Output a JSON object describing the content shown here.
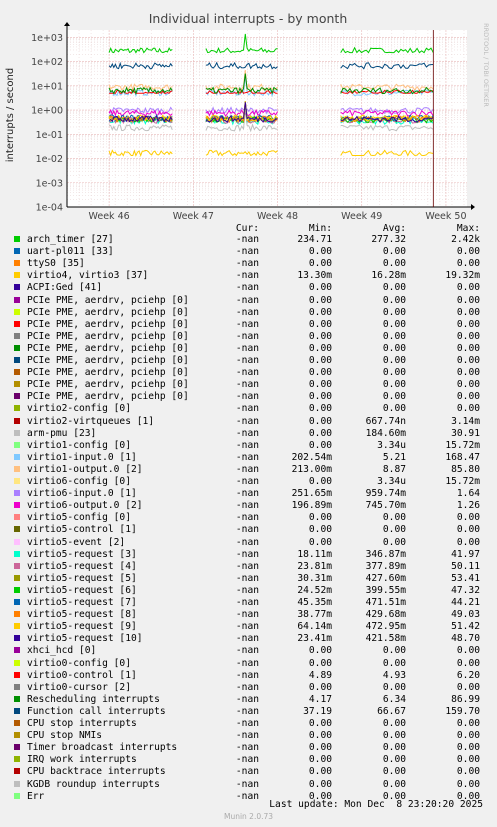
{
  "chart_data": {
    "type": "line",
    "title": "Individual interrupts - by month",
    "ylabel": "interrupts / second",
    "side_label": "RRDTOOL / TOBI OETIKER",
    "y_scale": "log",
    "ylim": [
      0.0001,
      2000
    ],
    "y_ticks": [
      "1e-04",
      "1e-03",
      "1e-02",
      "1e-01",
      "1e+00",
      "1e+01",
      "1e+02",
      "1e+03"
    ],
    "x_ticks": [
      "Week 46",
      "Week 47",
      "Week 48",
      "Week 49",
      "Week 50"
    ],
    "grid": true,
    "data_segments": [
      [
        46.0,
        46.75
      ],
      [
        47.15,
        48.0
      ],
      [
        48.75,
        49.85
      ]
    ],
    "now_marker": 49.85,
    "series": [
      {
        "name": "arch_timer [27]",
        "color": "#00cc00",
        "cur": "-nan",
        "min": "234.71",
        "avg": "277.32",
        "max": "2.42k"
      },
      {
        "name": "uart-pl011 [33]",
        "color": "#0066b3",
        "cur": "-nan",
        "min": "0.00",
        "avg": "0.00",
        "max": "0.00"
      },
      {
        "name": "ttyS0 [35]",
        "color": "#ff8000",
        "cur": "-nan",
        "min": "0.00",
        "avg": "0.00",
        "max": "0.00"
      },
      {
        "name": "virtio4, virtio3 [37]",
        "color": "#ffcc00",
        "cur": "-nan",
        "min": "13.30m",
        "avg": "16.28m",
        "max": "19.32m"
      },
      {
        "name": "ACPI:Ged [41]",
        "color": "#330099",
        "cur": "-nan",
        "min": "0.00",
        "avg": "0.00",
        "max": "0.00"
      },
      {
        "name": "PCIe PME, aerdrv, pciehp [0]",
        "color": "#990099",
        "cur": "-nan",
        "min": "0.00",
        "avg": "0.00",
        "max": "0.00"
      },
      {
        "name": "PCIe PME, aerdrv, pciehp [0]",
        "color": "#ccff00",
        "cur": "-nan",
        "min": "0.00",
        "avg": "0.00",
        "max": "0.00"
      },
      {
        "name": "PCIe PME, aerdrv, pciehp [0]",
        "color": "#ff0000",
        "cur": "-nan",
        "min": "0.00",
        "avg": "0.00",
        "max": "0.00"
      },
      {
        "name": "PCIe PME, aerdrv, pciehp [0]",
        "color": "#808080",
        "cur": "-nan",
        "min": "0.00",
        "avg": "0.00",
        "max": "0.00"
      },
      {
        "name": "PCIe PME, aerdrv, pciehp [0]",
        "color": "#008f00",
        "cur": "-nan",
        "min": "0.00",
        "avg": "0.00",
        "max": "0.00"
      },
      {
        "name": "PCIe PME, aerdrv, pciehp [0]",
        "color": "#00487d",
        "cur": "-nan",
        "min": "0.00",
        "avg": "0.00",
        "max": "0.00"
      },
      {
        "name": "PCIe PME, aerdrv, pciehp [0]",
        "color": "#b35a00",
        "cur": "-nan",
        "min": "0.00",
        "avg": "0.00",
        "max": "0.00"
      },
      {
        "name": "PCIe PME, aerdrv, pciehp [0]",
        "color": "#b38f00",
        "cur": "-nan",
        "min": "0.00",
        "avg": "0.00",
        "max": "0.00"
      },
      {
        "name": "PCIe PME, aerdrv, pciehp [0]",
        "color": "#6b006b",
        "cur": "-nan",
        "min": "0.00",
        "avg": "0.00",
        "max": "0.00"
      },
      {
        "name": "virtio2-config [0]",
        "color": "#8fb300",
        "cur": "-nan",
        "min": "0.00",
        "avg": "0.00",
        "max": "0.00"
      },
      {
        "name": "virtio2-virtqueues [1]",
        "color": "#b30000",
        "cur": "-nan",
        "min": "0.00",
        "avg": "667.74n",
        "max": "3.14m"
      },
      {
        "name": "arm-pmu [23]",
        "color": "#bebebe",
        "cur": "-nan",
        "min": "0.00",
        "avg": "184.60m",
        "max": "30.91"
      },
      {
        "name": "virtio1-config [0]",
        "color": "#80ff80",
        "cur": "-nan",
        "min": "0.00",
        "avg": "3.34u",
        "max": "15.72m"
      },
      {
        "name": "virtio1-input.0 [1]",
        "color": "#80c9ff",
        "cur": "-nan",
        "min": "202.54m",
        "avg": "5.21",
        "max": "168.47"
      },
      {
        "name": "virtio1-output.0 [2]",
        "color": "#ffc080",
        "cur": "-nan",
        "min": "213.00m",
        "avg": "8.87",
        "max": "85.80"
      },
      {
        "name": "virtio6-config [0]",
        "color": "#ffe680",
        "cur": "-nan",
        "min": "0.00",
        "avg": "3.34u",
        "max": "15.72m"
      },
      {
        "name": "virtio6-input.0 [1]",
        "color": "#aa80ff",
        "cur": "-nan",
        "min": "251.65m",
        "avg": "959.74m",
        "max": "1.64"
      },
      {
        "name": "virtio6-output.0 [2]",
        "color": "#ee00cc",
        "cur": "-nan",
        "min": "196.89m",
        "avg": "745.70m",
        "max": "1.26"
      },
      {
        "name": "virtio5-config [0]",
        "color": "#ff8080",
        "cur": "-nan",
        "min": "0.00",
        "avg": "0.00",
        "max": "0.00"
      },
      {
        "name": "virtio5-control [1]",
        "color": "#666600",
        "cur": "-nan",
        "min": "0.00",
        "avg": "0.00",
        "max": "0.00"
      },
      {
        "name": "virtio5-event [2]",
        "color": "#ffbfff",
        "cur": "-nan",
        "min": "0.00",
        "avg": "0.00",
        "max": "0.00"
      },
      {
        "name": "virtio5-request [3]",
        "color": "#00ffcc",
        "cur": "-nan",
        "min": "18.11m",
        "avg": "346.87m",
        "max": "41.97"
      },
      {
        "name": "virtio5-request [4]",
        "color": "#cc6699",
        "cur": "-nan",
        "min": "23.81m",
        "avg": "377.89m",
        "max": "50.11"
      },
      {
        "name": "virtio5-request [5]",
        "color": "#999900",
        "cur": "-nan",
        "min": "30.31m",
        "avg": "427.60m",
        "max": "53.41"
      },
      {
        "name": "virtio5-request [6]",
        "color": "#00cc00",
        "cur": "-nan",
        "min": "24.52m",
        "avg": "399.55m",
        "max": "47.32"
      },
      {
        "name": "virtio5-request [7]",
        "color": "#0066b3",
        "cur": "-nan",
        "min": "45.35m",
        "avg": "471.51m",
        "max": "44.21"
      },
      {
        "name": "virtio5-request [8]",
        "color": "#ff8000",
        "cur": "-nan",
        "min": "38.77m",
        "avg": "429.68m",
        "max": "49.03"
      },
      {
        "name": "virtio5-request [9]",
        "color": "#ffcc00",
        "cur": "-nan",
        "min": "64.14m",
        "avg": "472.95m",
        "max": "51.42"
      },
      {
        "name": "virtio5-request [10]",
        "color": "#330099",
        "cur": "-nan",
        "min": "23.41m",
        "avg": "421.58m",
        "max": "48.70"
      },
      {
        "name": "xhci_hcd [0]",
        "color": "#990099",
        "cur": "-nan",
        "min": "0.00",
        "avg": "0.00",
        "max": "0.00"
      },
      {
        "name": "virtio0-config [0]",
        "color": "#ccff00",
        "cur": "-nan",
        "min": "0.00",
        "avg": "0.00",
        "max": "0.00"
      },
      {
        "name": "virtio0-control [1]",
        "color": "#ff0000",
        "cur": "-nan",
        "min": "4.89",
        "avg": "4.93",
        "max": "6.20"
      },
      {
        "name": "virtio0-cursor [2]",
        "color": "#808080",
        "cur": "-nan",
        "min": "0.00",
        "avg": "0.00",
        "max": "0.00"
      },
      {
        "name": "Rescheduling interrupts",
        "color": "#008f00",
        "cur": "-nan",
        "min": "4.17",
        "avg": "6.34",
        "max": "86.99"
      },
      {
        "name": "Function call interrupts",
        "color": "#00487d",
        "cur": "-nan",
        "min": "37.19",
        "avg": "66.67",
        "max": "159.70"
      },
      {
        "name": "CPU stop interrupts",
        "color": "#b35a00",
        "cur": "-nan",
        "min": "0.00",
        "avg": "0.00",
        "max": "0.00"
      },
      {
        "name": "CPU stop NMIs",
        "color": "#b38f00",
        "cur": "-nan",
        "min": "0.00",
        "avg": "0.00",
        "max": "0.00"
      },
      {
        "name": "Timer broadcast interrupts",
        "color": "#6b006b",
        "cur": "-nan",
        "min": "0.00",
        "avg": "0.00",
        "max": "0.00"
      },
      {
        "name": "IRQ work interrupts",
        "color": "#8fb300",
        "cur": "-nan",
        "min": "0.00",
        "avg": "0.00",
        "max": "0.00"
      },
      {
        "name": "CPU backtrace interrupts",
        "color": "#b30000",
        "cur": "-nan",
        "min": "0.00",
        "avg": "0.00",
        "max": "0.00"
      },
      {
        "name": "KGDB roundup interrupts",
        "color": "#bebebe",
        "cur": "-nan",
        "min": "0.00",
        "avg": "0.00",
        "max": "0.00"
      },
      {
        "name": "Err",
        "color": "#80ff80",
        "cur": "-nan",
        "min": "0.00",
        "avg": "0.00",
        "max": "0.00"
      }
    ]
  },
  "legend_headers": {
    "cur": "Cur:",
    "min": "Min:",
    "avg": "Avg:",
    "max": "Max:"
  },
  "footer": {
    "last_update": "Last update: Mon Dec  8 23:20:20 2025",
    "munin": "Munin 2.0.73"
  }
}
